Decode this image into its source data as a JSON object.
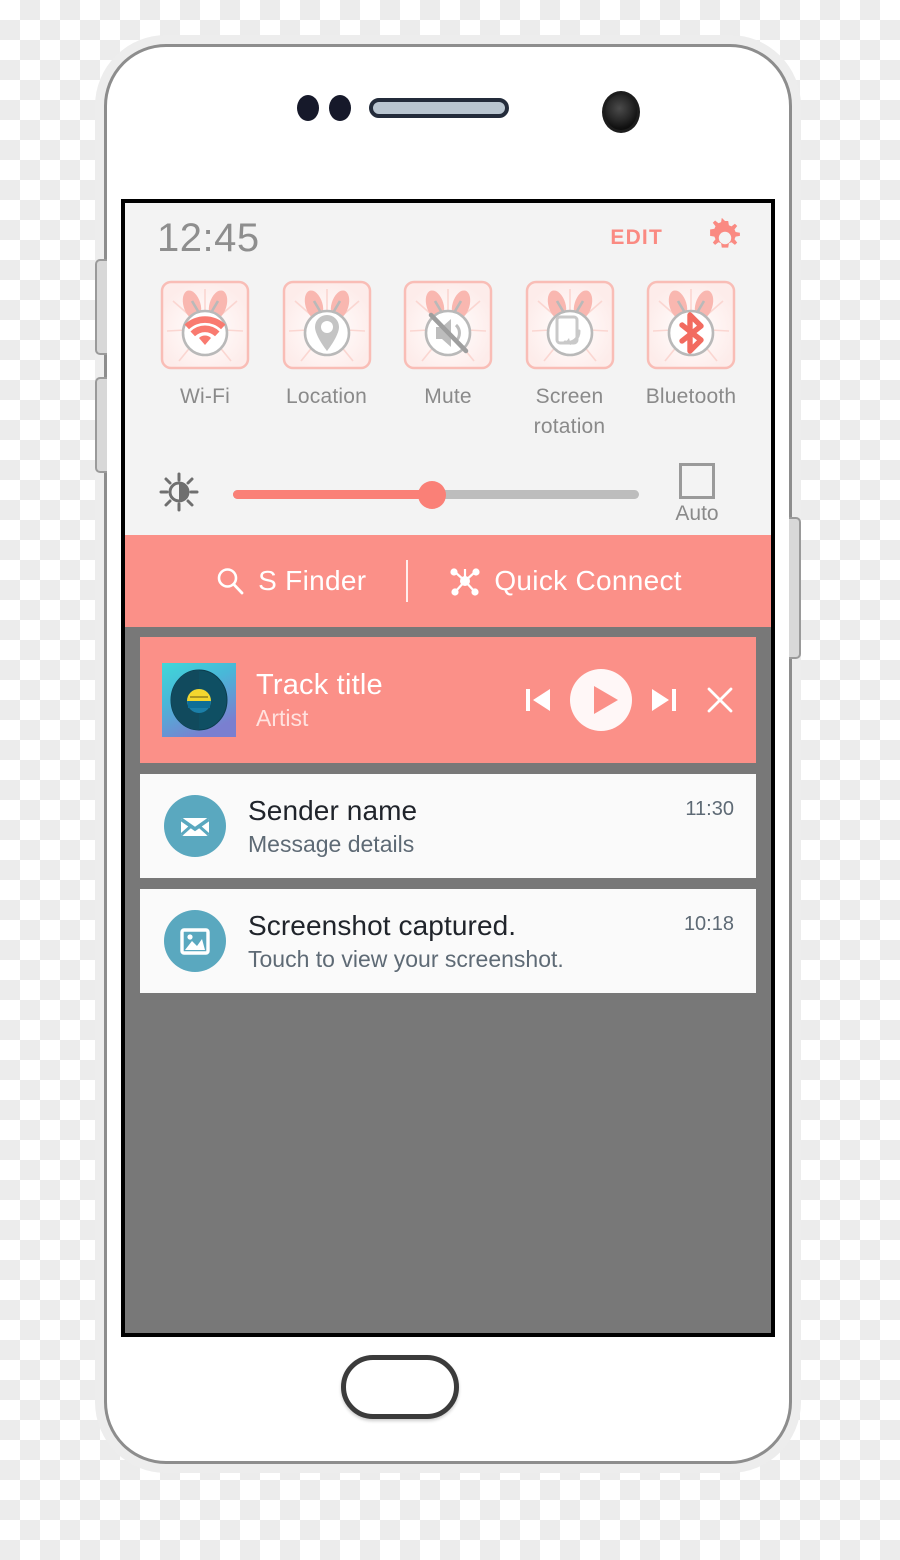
{
  "colors": {
    "accent_coral": "#fb9088",
    "accent_coral_strong": "#fa7068",
    "slider_fill": "#fa8077",
    "panel_bg": "#f3f3f3",
    "notif_panel_bg": "#787878",
    "avatar_teal": "#5aa8bf",
    "text_gray": "#8a8a8a",
    "notif_title": "#20242b"
  },
  "status_bar": {
    "clock": "12:45",
    "edit_label": "EDIT",
    "gear_icon": "gear-icon"
  },
  "quick_toggles": [
    {
      "label": "Wi-Fi",
      "icon": "wifi-icon",
      "active": true
    },
    {
      "label": "Location",
      "icon": "location-pin-icon",
      "active": false
    },
    {
      "label": "Mute",
      "icon": "mute-icon",
      "active": false
    },
    {
      "label": "Screen\nrotation",
      "icon": "screen-rotation-icon",
      "active": false
    },
    {
      "label": "Bluetooth",
      "icon": "bluetooth-icon",
      "active": true
    }
  ],
  "brightness": {
    "icon": "brightness-sun-icon",
    "value_percent": 49,
    "auto_label": "Auto",
    "auto_checked": false
  },
  "finder_bar": {
    "s_finder": {
      "label": "S Finder",
      "icon": "search-icon"
    },
    "quick_connect": {
      "label": "Quick Connect",
      "icon": "quick-connect-hub-icon"
    }
  },
  "music_notification": {
    "album_art": "vinyl-record-album-art",
    "title": "Track title",
    "artist": "Artist",
    "controls": {
      "previous": "skip-previous-icon",
      "play": "play-icon",
      "next": "skip-next-icon",
      "close": "close-icon"
    }
  },
  "notifications": [
    {
      "icon": "envelope-icon",
      "title": "Sender name",
      "subtitle": "Message details",
      "time": "11:30"
    },
    {
      "icon": "image-icon",
      "title": "Screenshot captured.",
      "subtitle": "Touch to view your screenshot.",
      "time": "10:18"
    }
  ],
  "device": {
    "earpiece": "earpiece-speaker",
    "front_camera": "front-camera",
    "home_button": "home-button",
    "volume_up": "volume-up-button",
    "volume_down": "volume-down-button",
    "power": "power-button"
  }
}
